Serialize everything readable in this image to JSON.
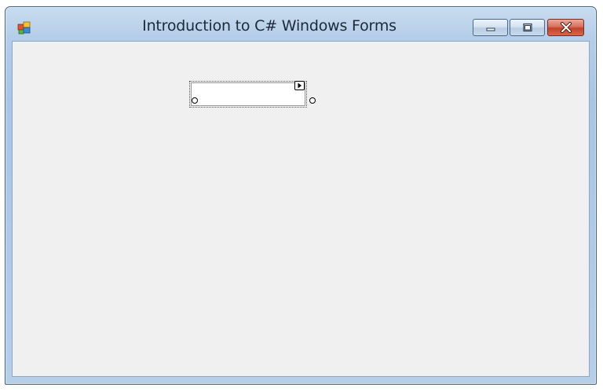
{
  "window": {
    "title": "Introduction to C# Windows Forms"
  },
  "controls": {
    "minimize_icon": "minimize-icon",
    "maximize_icon": "maximize-icon",
    "close_icon": "close-icon",
    "app_icon": "windows-form-icon"
  },
  "designer": {
    "textbox_value": "",
    "smart_tag_icon": "smart-tag-arrow-icon"
  },
  "colors": {
    "titlebar": "#b4cde8",
    "client": "#f0f0f0",
    "close_button": "#c4412a"
  }
}
